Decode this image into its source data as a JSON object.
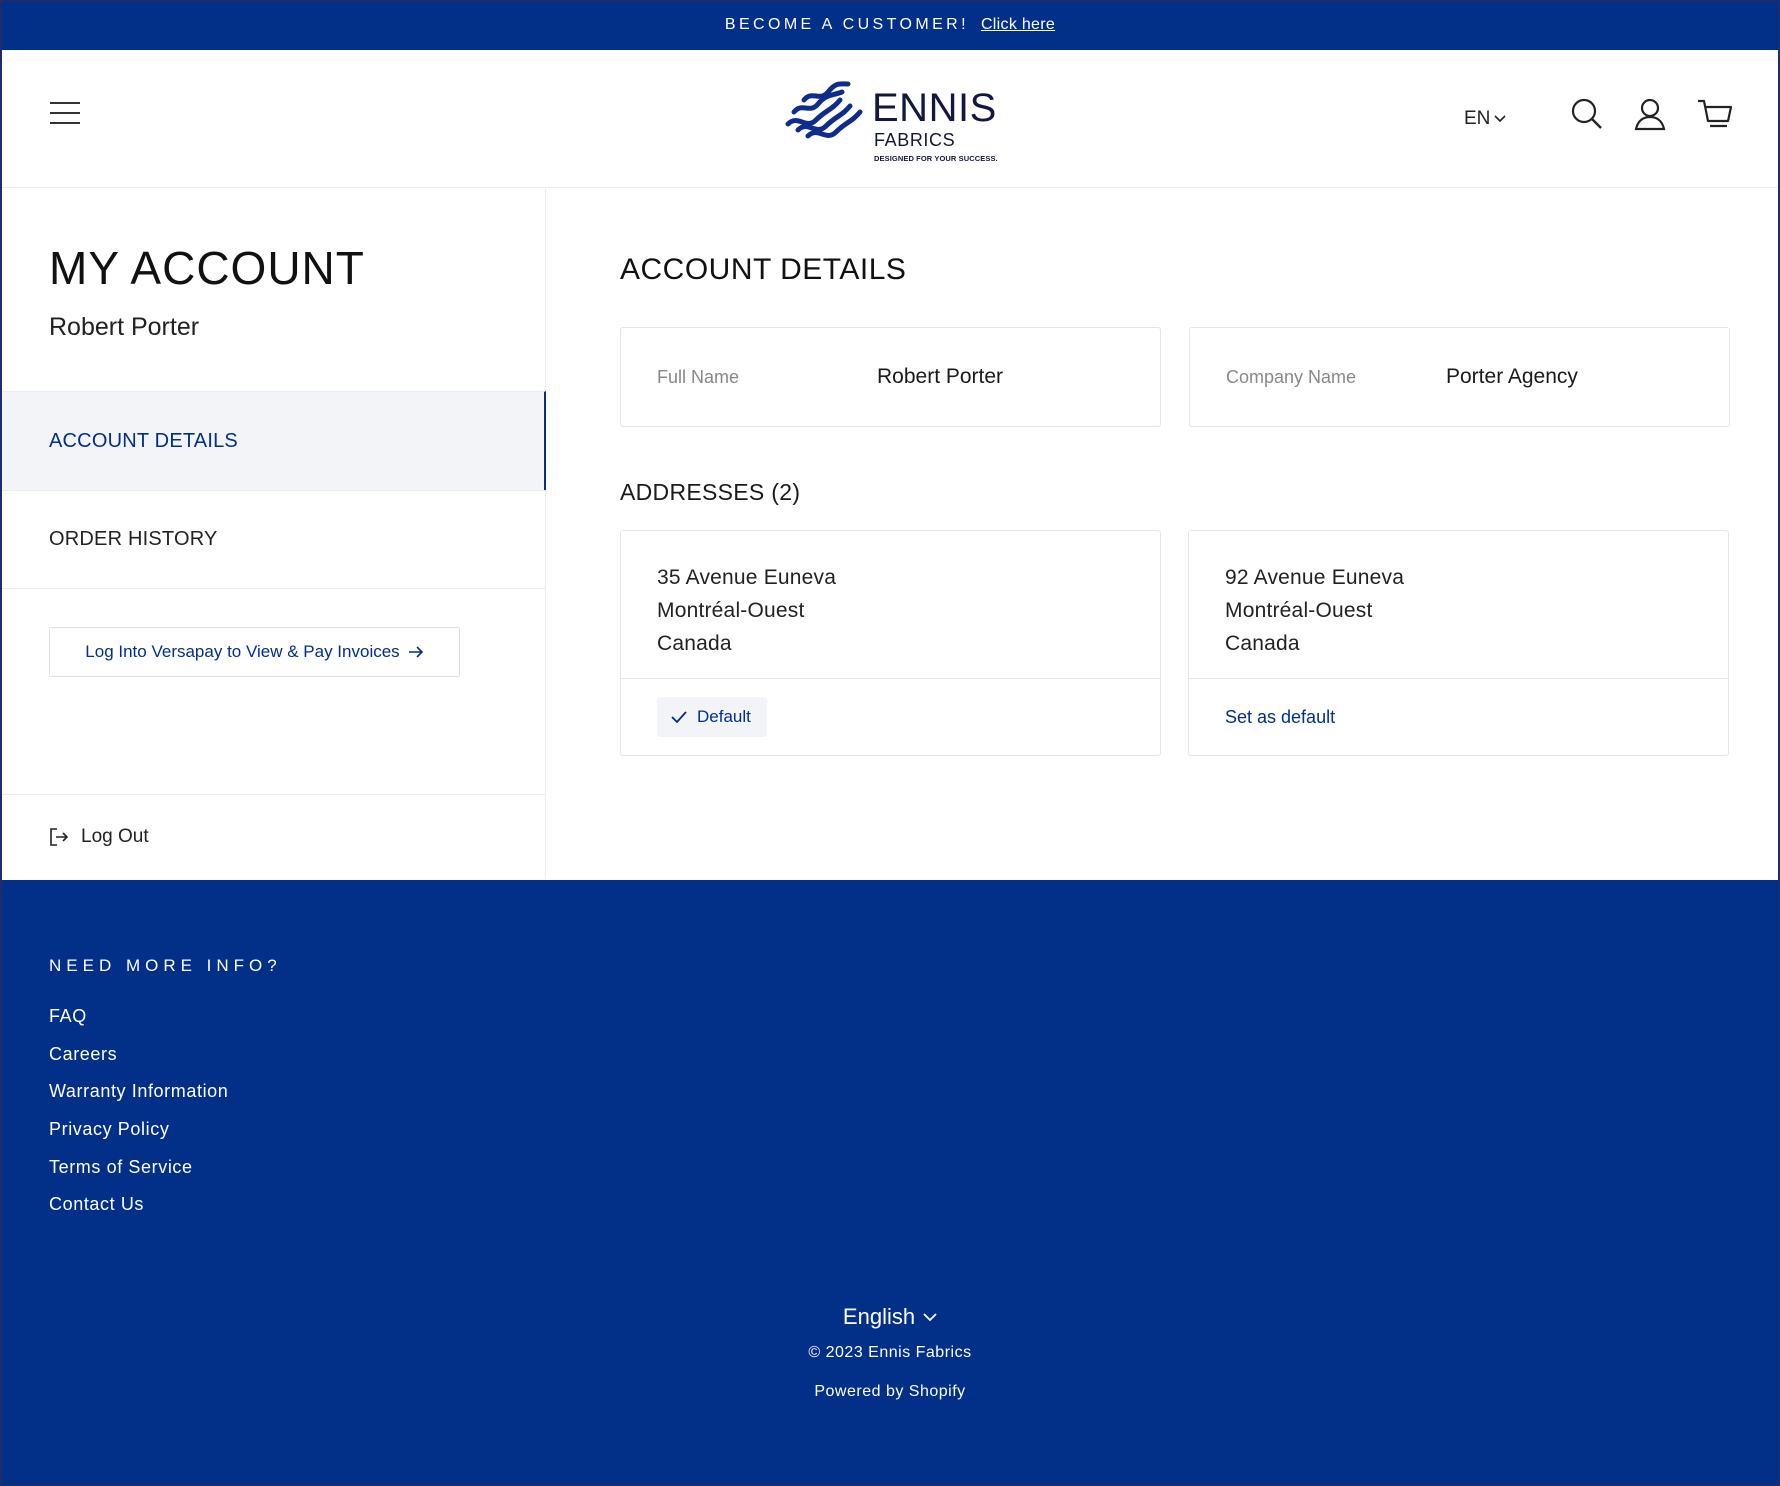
{
  "announcement": {
    "text": "BECOME A CUSTOMER!",
    "link": "Click here"
  },
  "header": {
    "logo": {
      "name": "ENNIS",
      "sub": "FABRICS",
      "tagline": "DESIGNED FOR YOUR SUCCESS."
    },
    "lang": "EN",
    "icons": [
      "menu-icon",
      "search-icon",
      "account-icon",
      "cart-icon"
    ]
  },
  "sidebar": {
    "title": "MY ACCOUNT",
    "user_name": "Robert Porter",
    "nav": [
      {
        "label": "ACCOUNT DETAILS",
        "active": true
      },
      {
        "label": "ORDER HISTORY",
        "active": false
      }
    ],
    "versapay_button": "Log Into Versapay to View & Pay Invoices",
    "logout": "Log Out"
  },
  "main": {
    "title": "ACCOUNT DETAILS",
    "full_name": {
      "label": "Full Name",
      "value": "Robert Porter"
    },
    "company_name": {
      "label": "Company Name",
      "value": "Porter Agency"
    },
    "addresses_title": "ADDRESSES (2)",
    "addresses": [
      {
        "line1": "35 Avenue Euneva",
        "line2": "Montréal-Ouest",
        "line3": "Canada",
        "action": "Default",
        "is_default": true
      },
      {
        "line1": "92 Avenue Euneva",
        "line2": "Montréal-Ouest",
        "line3": "Canada",
        "action": "Set as default",
        "is_default": false
      }
    ]
  },
  "footer": {
    "heading": "NEED MORE INFO?",
    "links": [
      "FAQ",
      "Careers",
      "Warranty Information",
      "Privacy Policy",
      "Terms of Service",
      "Contact Us"
    ],
    "language": "English",
    "copyright": "© 2023 Ennis Fabrics",
    "powered": "Powered by Shopify"
  },
  "colors": {
    "brand": "#022f88",
    "panel": "#f2f4f8",
    "border": "#e3e5ea"
  }
}
